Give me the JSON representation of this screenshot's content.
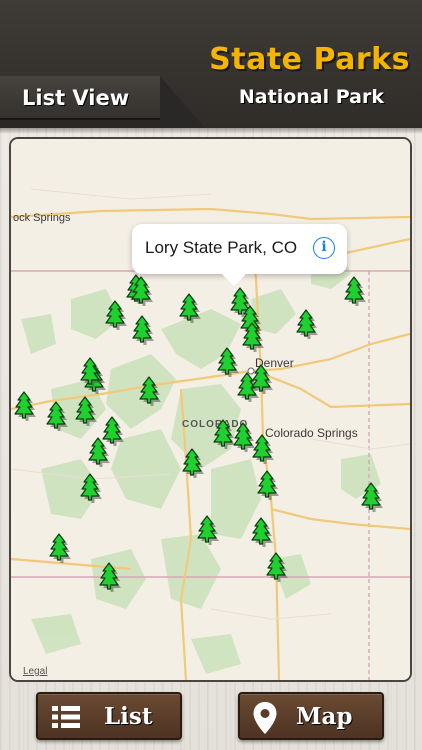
{
  "header": {
    "title": "State Parks",
    "subtitle": "National Park",
    "view_tab": "List View"
  },
  "map": {
    "callout": {
      "text": "Lory State Park, CO",
      "action_icon": "info-icon"
    },
    "labels": {
      "rock_springs": "ock Springs",
      "denver": "Denver",
      "colorado": "COLORADO",
      "colorado_springs": "Colorado Springs"
    },
    "legal": "Legal",
    "marker_icon": "tree-icon",
    "marker_color": "#1fd12f"
  },
  "bottom_bar": {
    "list_button": {
      "label": "List",
      "icon": "list-icon"
    },
    "map_button": {
      "label": "Map",
      "icon": "map-pin-icon"
    }
  },
  "colors": {
    "title": "#f5b400",
    "header_bg": "#34312e",
    "button_bg": "#5a3d29",
    "info_blue": "#1a7ef2"
  }
}
